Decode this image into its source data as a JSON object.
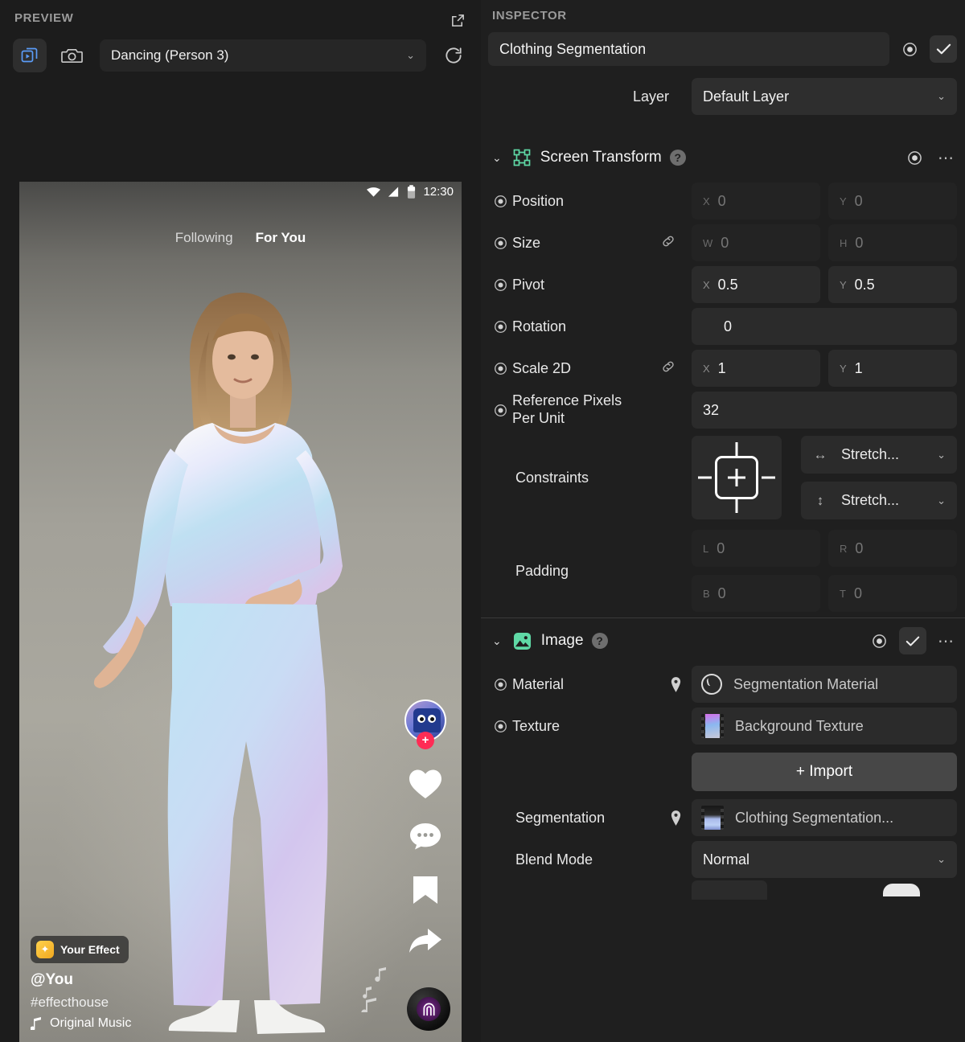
{
  "preview": {
    "title": "PREVIEW",
    "popout_icon": "external-link-icon",
    "video_mode_icon": "video-layers-play-icon",
    "photo_mode_icon": "camera-icon",
    "refresh_icon": "refresh-icon",
    "scene": {
      "selected": "Dancing (Person 3)",
      "chevron": "⌄"
    },
    "phone": {
      "status": {
        "time": "12:30",
        "wifi_icon": "wifi-icon",
        "signal_icon": "signal-icon",
        "battery_icon": "battery-icon"
      },
      "tabs": [
        {
          "label": "Following",
          "active": false
        },
        {
          "label": "For You",
          "active": true
        }
      ],
      "rail": {
        "avatar_icon": "profile-avatar",
        "follow_badge": "+",
        "like_icon": "heart-icon",
        "comment_icon": "comment-icon",
        "bookmark_icon": "bookmark-icon",
        "share_icon": "share-arrow-icon"
      },
      "overlay": {
        "effect_chip_icon": "magic-wand-icon",
        "effect_chip_label": "Your Effect",
        "username": "@You",
        "hashtag": "#effecthouse",
        "music_note_icon": "music-note-icon",
        "music_label": "Original Music",
        "disc_icon": "music-disc-icon",
        "floating_notes_icon": "floating-music-notes-icon"
      }
    }
  },
  "inspector": {
    "title": "INSPECTOR",
    "object_name": "Clothing Segmentation",
    "object_keyframe_icon": "keyframe-icon",
    "object_enabled_icon": "checkmark-icon",
    "layer": {
      "label": "Layer",
      "value": "Default Layer",
      "chevron": "⌄"
    },
    "sections": [
      {
        "id": "screen_transform",
        "name": "Screen Transform",
        "icon": "screen-transform-icon",
        "caret": "⌄",
        "help": "?",
        "keyframe_icon": "keyframe-icon",
        "more_icon": "more-options-icon",
        "rows": {
          "position": {
            "label": "Position",
            "x_axis": "X",
            "x": "0",
            "y_axis": "Y",
            "y": "0",
            "disabled": true
          },
          "size": {
            "label": "Size",
            "link_icon": "link-icon",
            "w_axis": "W",
            "w": "0",
            "h_axis": "H",
            "h": "0",
            "disabled": true
          },
          "pivot": {
            "label": "Pivot",
            "x_axis": "X",
            "x": "0.5",
            "y_axis": "Y",
            "y": "0.5",
            "disabled": false
          },
          "rotation": {
            "label": "Rotation",
            "value": "0",
            "disabled": false
          },
          "scale2d": {
            "label": "Scale 2D",
            "link_icon": "link-icon",
            "x_axis": "X",
            "x": "1",
            "y_axis": "Y",
            "y": "1",
            "disabled": false
          },
          "reference_ppu": {
            "label": "Reference Pixels Per Unit",
            "value": "32",
            "disabled": false
          },
          "constraints": {
            "label": "Constraints",
            "horizontal": {
              "icon": "horizontal-arrows-icon",
              "value": "Stretch...",
              "chevron": "⌄"
            },
            "vertical": {
              "icon": "vertical-arrows-icon",
              "value": "Stretch...",
              "chevron": "⌄"
            }
          },
          "padding": {
            "label": "Padding",
            "l_axis": "L",
            "l": "0",
            "r_axis": "R",
            "r": "0",
            "b_axis": "B",
            "b": "0",
            "t_axis": "T",
            "t": "0",
            "disabled": true
          }
        }
      },
      {
        "id": "image",
        "name": "Image",
        "icon": "image-icon",
        "caret": "⌄",
        "help": "?",
        "keyframe_icon": "keyframe-icon",
        "enabled_icon": "checkmark-icon",
        "more_icon": "more-options-icon",
        "rows": {
          "material": {
            "label": "Material",
            "pin_icon": "pin-icon",
            "thumb_icon": "material-sphere-icon",
            "value": "Segmentation Material"
          },
          "texture": {
            "label": "Texture",
            "thumb_icon": "texture-thumbnail",
            "value": "Background Texture"
          },
          "import": {
            "label": "+ Import"
          },
          "segmentation": {
            "label": "Segmentation",
            "pin_icon": "pin-icon",
            "thumb_icon": "segmentation-thumbnail",
            "value": "Clothing Segmentation..."
          },
          "blend_mode": {
            "label": "Blend Mode",
            "value": "Normal",
            "chevron": "⌄"
          }
        }
      }
    ]
  },
  "colors": {
    "app_bg": "#1c1c1c",
    "inspector_bg": "#1f1f1f",
    "field_bg": "#2b2b2b",
    "field_disabled_bg": "#232323",
    "accent_green": "#5fd9a6",
    "accent_blue": "#5b9cf8",
    "accent_red": "#fe2c55",
    "text_primary": "#f2f2f2",
    "text_muted": "#9a9a9a"
  }
}
